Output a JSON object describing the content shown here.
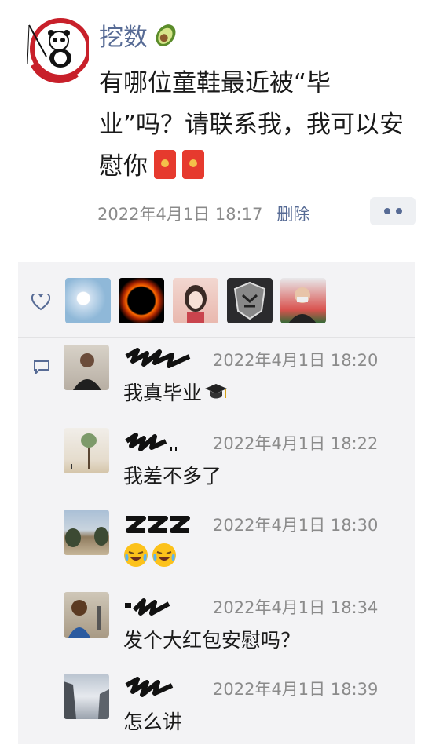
{
  "post": {
    "author": "挖数",
    "text": "有哪位童鞋最近被“毕业”吗？请联系我，我可以安慰你",
    "timestamp": "2022年4月1日 18:17",
    "delete_label": "删除",
    "icons": [
      "avocado-icon",
      "red-envelope-icon",
      "red-envelope-icon"
    ]
  },
  "likes": {
    "icon": "heart-icon",
    "count_avatars": 5
  },
  "comments": [
    {
      "time": "2022年4月1日 18:20",
      "text": "我真毕业",
      "emoji": "graduation-cap-icon"
    },
    {
      "time": "2022年4月1日 18:22",
      "text": "我差不多了",
      "emoji": ""
    },
    {
      "time": "2022年4月1日 18:30",
      "text": "",
      "emoji": "laughing-crying-icon"
    },
    {
      "time": "2022年4月1日 18:34",
      "text": "发个大红包安慰吗？",
      "emoji": ""
    },
    {
      "time": "2022年4月1日 18:39",
      "text": "怎么讲",
      "emoji": ""
    }
  ],
  "colors": {
    "link_blue": "#576b95",
    "meta_gray": "#8b8b8b",
    "panel_bg": "#f3f3f5",
    "red_envelope": "#e63a2e"
  }
}
